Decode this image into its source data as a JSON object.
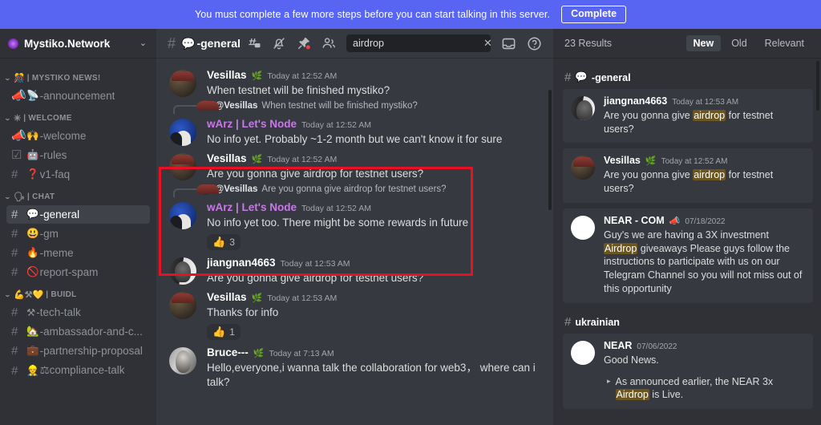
{
  "banner": {
    "text": "You must complete a few more steps before you can start talking in this server.",
    "button": "Complete"
  },
  "sidebar": {
    "server_name": "Mystiko.Network",
    "chevron": "⌄",
    "groups": [
      {
        "label": "| MYSTIKO NEWS!",
        "emoji": "🎊",
        "channels": [
          {
            "glyph": "📣",
            "emoji": "📡",
            "name": "-announcement",
            "active": false
          }
        ]
      },
      {
        "label": "| WELCOME",
        "emoji": "✳",
        "channels": [
          {
            "glyph": "📣",
            "emoji": "🙌",
            "name": "-welcome",
            "active": false
          },
          {
            "glyph": "☑",
            "emoji": "🤖",
            "name": "-rules",
            "active": false
          },
          {
            "glyph": "#",
            "emoji": "❓",
            "name": "v1-faq",
            "active": false
          }
        ]
      },
      {
        "label": "| CHAT",
        "emoji": "🗣",
        "channels": [
          {
            "glyph": "#",
            "emoji": "💬",
            "name": "-general",
            "active": true
          },
          {
            "glyph": "#",
            "emoji": "😃",
            "name": "-gm",
            "active": false
          },
          {
            "glyph": "#",
            "emoji": "🔥",
            "name": "-meme",
            "active": false
          },
          {
            "glyph": "#",
            "emoji": "🚫",
            "name": "report-spam",
            "active": false
          }
        ]
      },
      {
        "label": "| BUIDL",
        "emoji": "💪⚒💛",
        "channels": [
          {
            "glyph": "#",
            "emoji": "⚒",
            "name": "-tech-talk",
            "active": false
          },
          {
            "glyph": "#",
            "emoji": "🏡",
            "name": "-ambassador-and-c...",
            "active": false
          },
          {
            "glyph": "#",
            "emoji": "💼",
            "name": "-partnership-proposal",
            "active": false
          },
          {
            "glyph": "#",
            "emoji": "👷",
            "name": "⚖compliance-talk",
            "active": false
          }
        ]
      }
    ]
  },
  "channel_header": {
    "hash": "#",
    "emoji": "💬",
    "name": "-general"
  },
  "search": {
    "value": "airdrop",
    "placeholder": "Search",
    "clear": "✕"
  },
  "messages": [
    {
      "id": "m1",
      "avatar": "av-vesillas",
      "author": "Vesillas",
      "badge": "🌿",
      "timestamp": "Today at 12:52 AM",
      "text": "When testnet will be finished mystiko?",
      "name_color": "white"
    },
    {
      "id": "m2",
      "avatar": "av-warz",
      "author": "wArz | Let's Node",
      "timestamp": "Today at 12:52 AM",
      "text": "No info yet. Probably ~1-2 month but we can't know it for sure",
      "name_color": "purple",
      "reply": {
        "mention": "@Vesillas",
        "text": "When testnet will be finished mystiko?",
        "avatar": "av-vesillas"
      }
    },
    {
      "id": "m3",
      "avatar": "av-vesillas",
      "author": "Vesillas",
      "badge": "🌿",
      "timestamp": "Today at 12:52 AM",
      "text": "Are you gonna give airdrop for testnet users?",
      "name_color": "white"
    },
    {
      "id": "m4",
      "avatar": "av-warz",
      "author": "wArz | Let's Node",
      "timestamp": "Today at 12:52 AM",
      "text": "No info yet too. There might be some rewards in future",
      "name_color": "purple",
      "reply": {
        "mention": "@Vesillas",
        "text": "Are you gonna give airdrop for testnet users?",
        "avatar": "av-vesillas"
      },
      "reaction": {
        "emoji": "👍",
        "count": "3"
      }
    },
    {
      "id": "m5",
      "avatar": "av-jiang",
      "author": "jiangnan4663",
      "timestamp": "Today at 12:53 AM",
      "text": "Are you gonna give airdrop for testnet users?",
      "name_color": "white"
    },
    {
      "id": "m6",
      "avatar": "av-vesillas",
      "author": "Vesillas",
      "badge": "🌿",
      "timestamp": "Today at 12:53 AM",
      "text": "Thanks for info",
      "name_color": "white",
      "reaction": {
        "emoji": "👍",
        "count": "1"
      }
    },
    {
      "id": "m7",
      "avatar": "av-bruce",
      "author": "Bruce---",
      "badge": "🌿",
      "timestamp": "Today at 7:13 AM",
      "text": "Hello,everyone,i wanna talk the collaboration for web3， where can i talk?",
      "name_color": "white"
    }
  ],
  "search_panel": {
    "results_count": "23 Results",
    "tabs": [
      {
        "label": "New",
        "selected": true
      },
      {
        "label": "Old",
        "selected": false
      },
      {
        "label": "Relevant",
        "selected": false
      }
    ],
    "sections": [
      {
        "channel_hash": "#",
        "channel_emoji": "💬",
        "channel_name": "-general",
        "results": [
          {
            "avatar": "av-jiang",
            "author": "jiangnan4663",
            "timestamp": "Today at 12:53 AM",
            "parts": [
              {
                "t": "Are you gonna give ",
                "hl": false
              },
              {
                "t": "airdrop",
                "hl": true
              },
              {
                "t": " for testnet users?",
                "hl": false
              }
            ]
          },
          {
            "avatar": "av-vesillas",
            "author": "Vesillas",
            "badge": "🌿",
            "timestamp": "Today at 12:52 AM",
            "parts": [
              {
                "t": "Are you gonna give ",
                "hl": false
              },
              {
                "t": "airdrop",
                "hl": true
              },
              {
                "t": " for testnet users?",
                "hl": false
              }
            ]
          },
          {
            "avatar": "av-near",
            "author": "NEAR - COM",
            "badge": "📣",
            "timestamp": "07/18/2022",
            "parts": [
              {
                "t": "Guy's we are having a 3X investment ",
                "hl": false
              },
              {
                "t": "Airdrop",
                "hl": true
              },
              {
                "t": " giveaways Please guys follow the instructions to participate with us on our Telegram Channel so you will not miss out of this opportunity",
                "hl": false
              }
            ]
          }
        ]
      },
      {
        "channel_hash": "#",
        "channel_emoji": "",
        "channel_name": "ukrainian",
        "results": [
          {
            "avatar": "av-near",
            "author": "NEAR",
            "timestamp": "07/06/2022",
            "parts": [
              {
                "t": "Good News.",
                "hl": false
              }
            ],
            "quote_arrow": "▸",
            "quote_parts": [
              {
                "t": "As announced earlier, the NEAR 3x ",
                "hl": false
              },
              {
                "t": "Airdrop",
                "hl": true
              },
              {
                "t": " is Live.",
                "hl": false
              }
            ]
          }
        ]
      }
    ]
  },
  "colors": {
    "accent_banner": "#5865f2",
    "sidebar_bg": "#2f3136",
    "chat_bg": "#36393f",
    "highlight_box": "#e81123",
    "search_highlight": "#6b5622",
    "username_purple": "#c879e8"
  }
}
